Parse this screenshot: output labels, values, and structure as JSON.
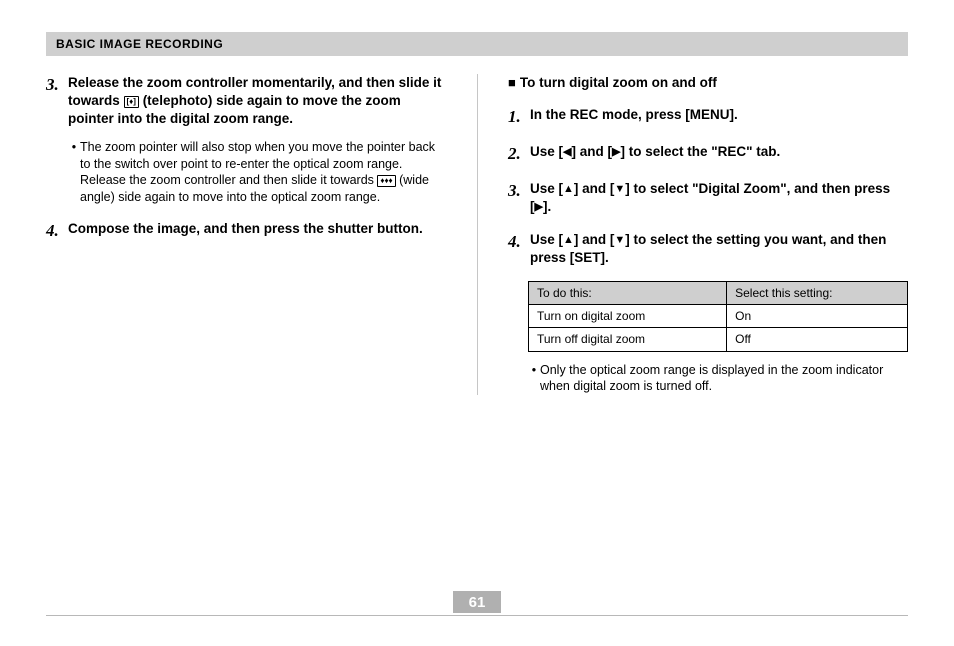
{
  "header": {
    "title": "BASIC IMAGE RECORDING"
  },
  "left": {
    "step3": {
      "num": "3.",
      "text_a": "Release the zoom controller momentarily, and then slide it towards ",
      "text_icon": "[♦]",
      "text_b": " (telephoto) side again to move the zoom pointer into the digital zoom range.",
      "bullet_a": "The zoom pointer will also stop when you move the pointer back to the switch over point to re-enter the optical zoom range. Release the zoom controller and then slide it towards ",
      "bullet_icon": "♦♦♦",
      "bullet_b": " (wide angle) side again to move into the optical zoom range."
    },
    "step4": {
      "num": "4.",
      "text": "Compose the image, and then press the shutter button."
    }
  },
  "right": {
    "heading": "To turn digital zoom on and off",
    "step1": {
      "num": "1.",
      "text": "In the REC mode, press [MENU]."
    },
    "step2": {
      "num": "2.",
      "a": "Use [",
      "left": "◀",
      "b": "] and [",
      "right": "▶",
      "c": "] to select the \"REC\" tab."
    },
    "step3": {
      "num": "3.",
      "a": "Use [",
      "up": "▲",
      "b": "] and [",
      "down": "▼",
      "c": "] to select \"Digital Zoom\", and then press [",
      "right": "▶",
      "d": "]."
    },
    "step4": {
      "num": "4.",
      "a": "Use [",
      "up": "▲",
      "b": "] and [",
      "down": "▼",
      "c": "] to select the setting you want, and then press [SET]."
    },
    "table": {
      "h1": "To do this:",
      "h2": "Select this setting:",
      "rows": [
        {
          "c1": "Turn on digital zoom",
          "c2": "On"
        },
        {
          "c1": "Turn off digital zoom",
          "c2": "Off"
        }
      ]
    },
    "note": "Only the optical zoom range is displayed in the zoom indicator when digital zoom is turned off."
  },
  "footer": {
    "page": "61"
  }
}
